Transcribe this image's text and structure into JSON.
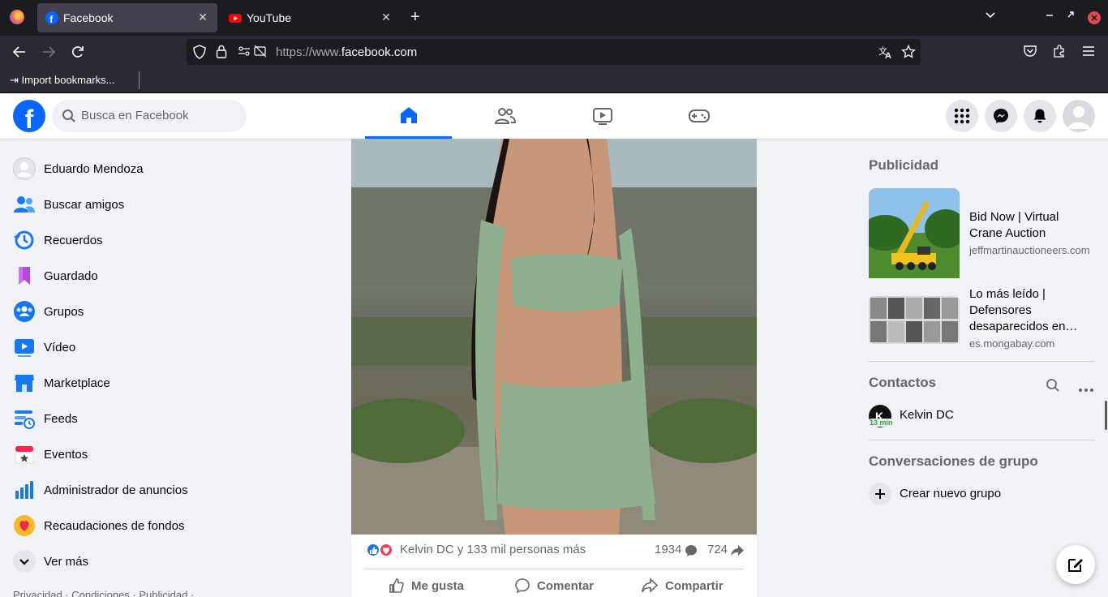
{
  "browser": {
    "tabs": [
      {
        "label": "Facebook",
        "active": true
      },
      {
        "label": "YouTube",
        "active": false
      }
    ],
    "url_prefix": "https://www.",
    "url_domain": "facebook.com",
    "bookmarks_label": "Import bookmarks..."
  },
  "header": {
    "search_placeholder": "Busca en Facebook"
  },
  "sidebar": {
    "items": [
      {
        "label": "Eduardo Mendoza",
        "icon": "profile-avatar-icon"
      },
      {
        "label": "Buscar amigos",
        "icon": "friends-icon"
      },
      {
        "label": "Recuerdos",
        "icon": "memories-clock-icon"
      },
      {
        "label": "Guardado",
        "icon": "bookmark-icon"
      },
      {
        "label": "Grupos",
        "icon": "groups-icon"
      },
      {
        "label": "Vídeo",
        "icon": "video-icon"
      },
      {
        "label": "Marketplace",
        "icon": "marketplace-icon"
      },
      {
        "label": "Feeds",
        "icon": "feeds-icon"
      },
      {
        "label": "Eventos",
        "icon": "events-icon"
      },
      {
        "label": "Administrador de anuncios",
        "icon": "ads-manager-icon"
      },
      {
        "label": "Recaudaciones de fondos",
        "icon": "fundraiser-icon"
      },
      {
        "label": "Ver más",
        "icon": "chevron-down-icon"
      }
    ],
    "footer": "Privacidad · Condiciones · Publicidad ·"
  },
  "post": {
    "reactions_text": "Kelvin DC y 133 mil personas más",
    "comments_count": "1934",
    "shares_count": "724",
    "like_label": "Me gusta",
    "comment_label": "Comentar",
    "share_label": "Compartir"
  },
  "right": {
    "ads_heading": "Publicidad",
    "ads": [
      {
        "title": "Bid Now | Virtual Crane Auction",
        "domain": "jeffmartinauctioneers.com"
      },
      {
        "title": "Lo más leído | Defensores desaparecidos en…",
        "domain": "es.mongabay.com"
      }
    ],
    "contacts_heading": "Contactos",
    "contacts": [
      {
        "name": "Kelvin DC",
        "status": "13 min"
      }
    ],
    "group_heading": "Conversaciones de grupo",
    "create_group_label": "Crear nuevo grupo"
  },
  "colors": {
    "brand": "#0866ff",
    "like": "#1877f2",
    "love": "#f33e58"
  }
}
